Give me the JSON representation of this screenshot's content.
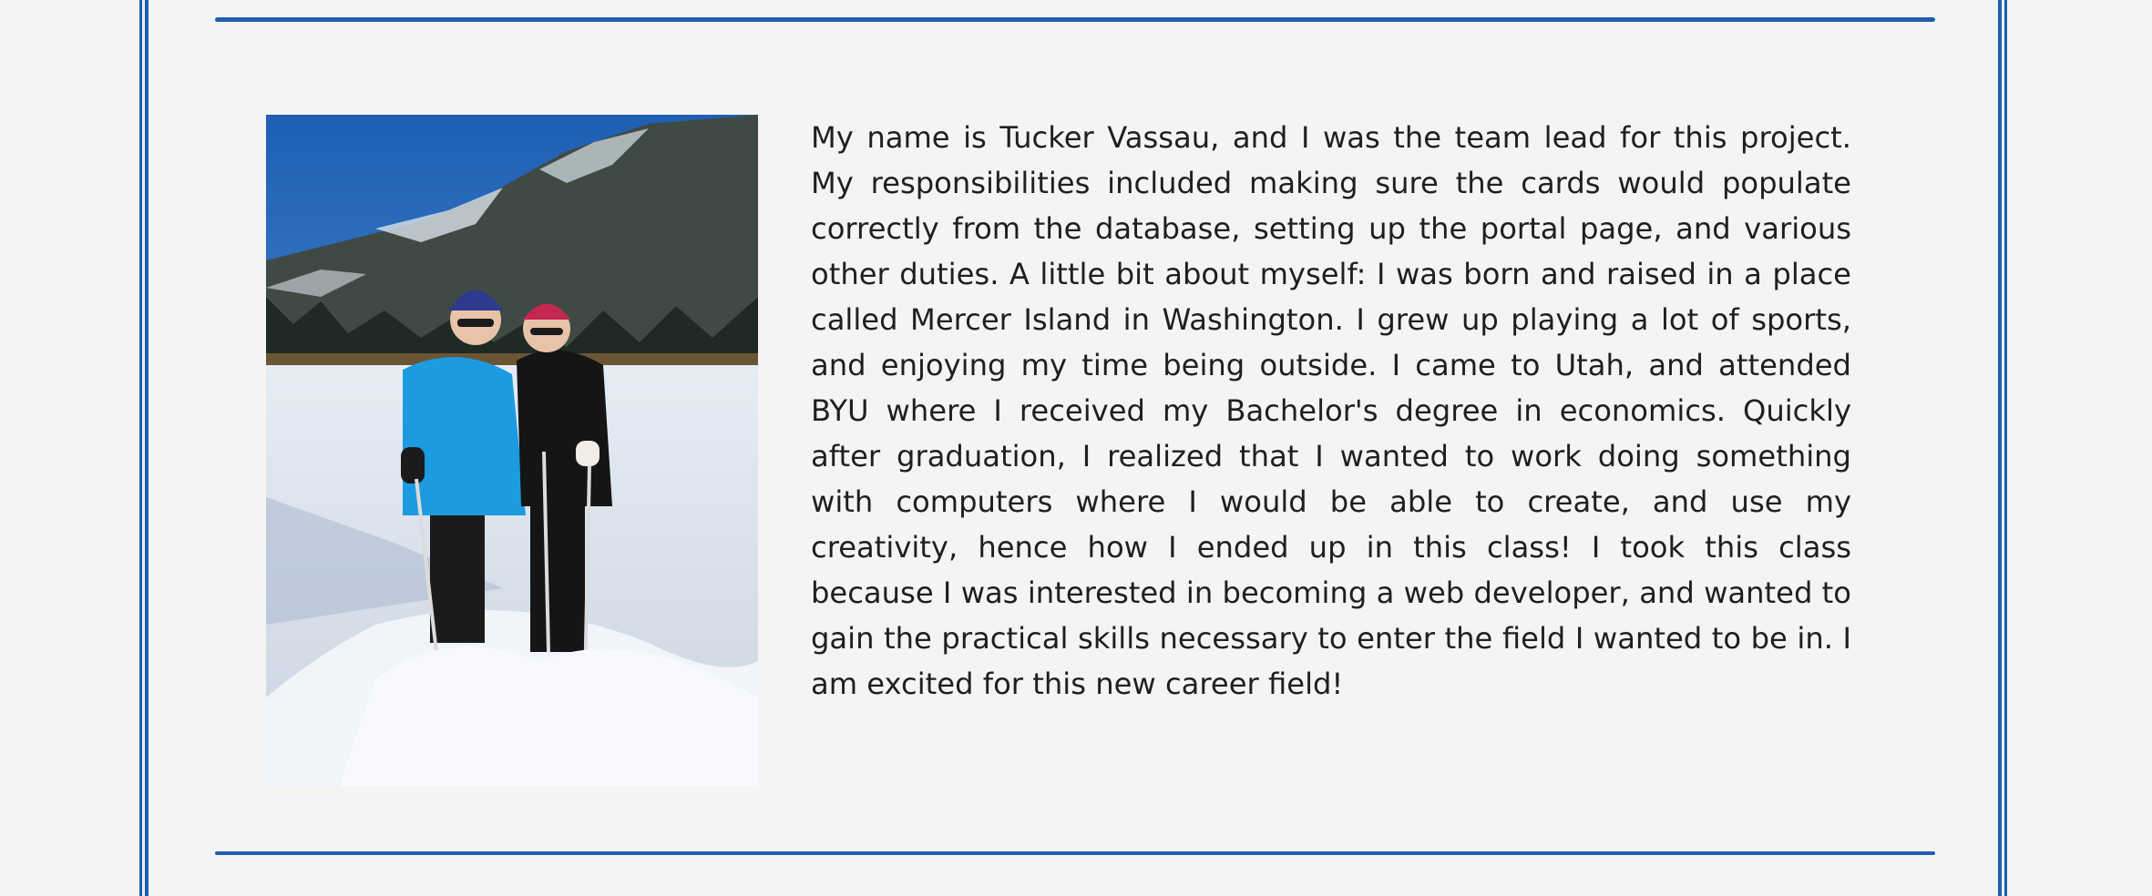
{
  "about": {
    "photo_alt": "Two people standing on snowy ground with trekking poles, forested mountain behind",
    "bio_text": "My name is Tucker Vassau, and I was the team lead for this project. My responsibilities included making sure the cards would populate correctly from the database, setting up the portal page, and various other duties. A little bit about myself: I was born and raised in a place called Mercer Island in Washington. I grew up playing a lot of sports, and enjoying my time being outside. I came to Utah, and attended BYU where I received my Bachelor's degree in economics. Quickly after graduation, I realized that I wanted to work doing something with computers where I would be able to create, and use my creativity, hence how I ended up in this class! I took this class because I was interested in becoming a web developer, and wanted to gain the practical skills necessary to enter the field I wanted to be in. I am excited for this new career field!"
  },
  "colors": {
    "accent": "#1f5fae",
    "background": "#f4f4f4",
    "text": "#1f1f1f"
  }
}
